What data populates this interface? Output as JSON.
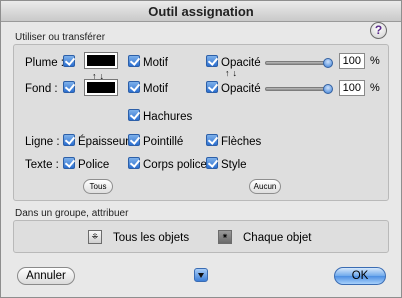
{
  "window": {
    "title": "Outil assignation"
  },
  "help": {
    "glyph": "?"
  },
  "section_transfer": {
    "label": "Utiliser ou transférer",
    "plume_label": "Plume :",
    "fond_label": "Fond :",
    "swap_glyph": "↑↓",
    "motif_label": "Motif",
    "opacite_label": "Opacité",
    "plume_opacity": "100",
    "fond_opacity": "100",
    "unit": "%",
    "hachures_label": "Hachures",
    "ligne_label": "Ligne :",
    "epaisseur_label": "Épaisseur",
    "pointille_label": "Pointillé",
    "fleches_label": "Flèches",
    "texte_label": "Texte :",
    "police_label": "Police",
    "corps_label": "Corps police",
    "style_label": "Style",
    "tous_label": "Tous",
    "aucun_label": "Aucun"
  },
  "section_group": {
    "label": "Dans un groupe, attribuer",
    "all_label": "Tous les objets",
    "each_label": "Chaque objet",
    "all_icon_glyph": "⁜",
    "each_icon_glyph": "⁕"
  },
  "footer": {
    "cancel_label": "Annuler",
    "ok_label": "OK"
  },
  "colors": {
    "accent": "#2b6fd0",
    "swatch": "#000000"
  }
}
